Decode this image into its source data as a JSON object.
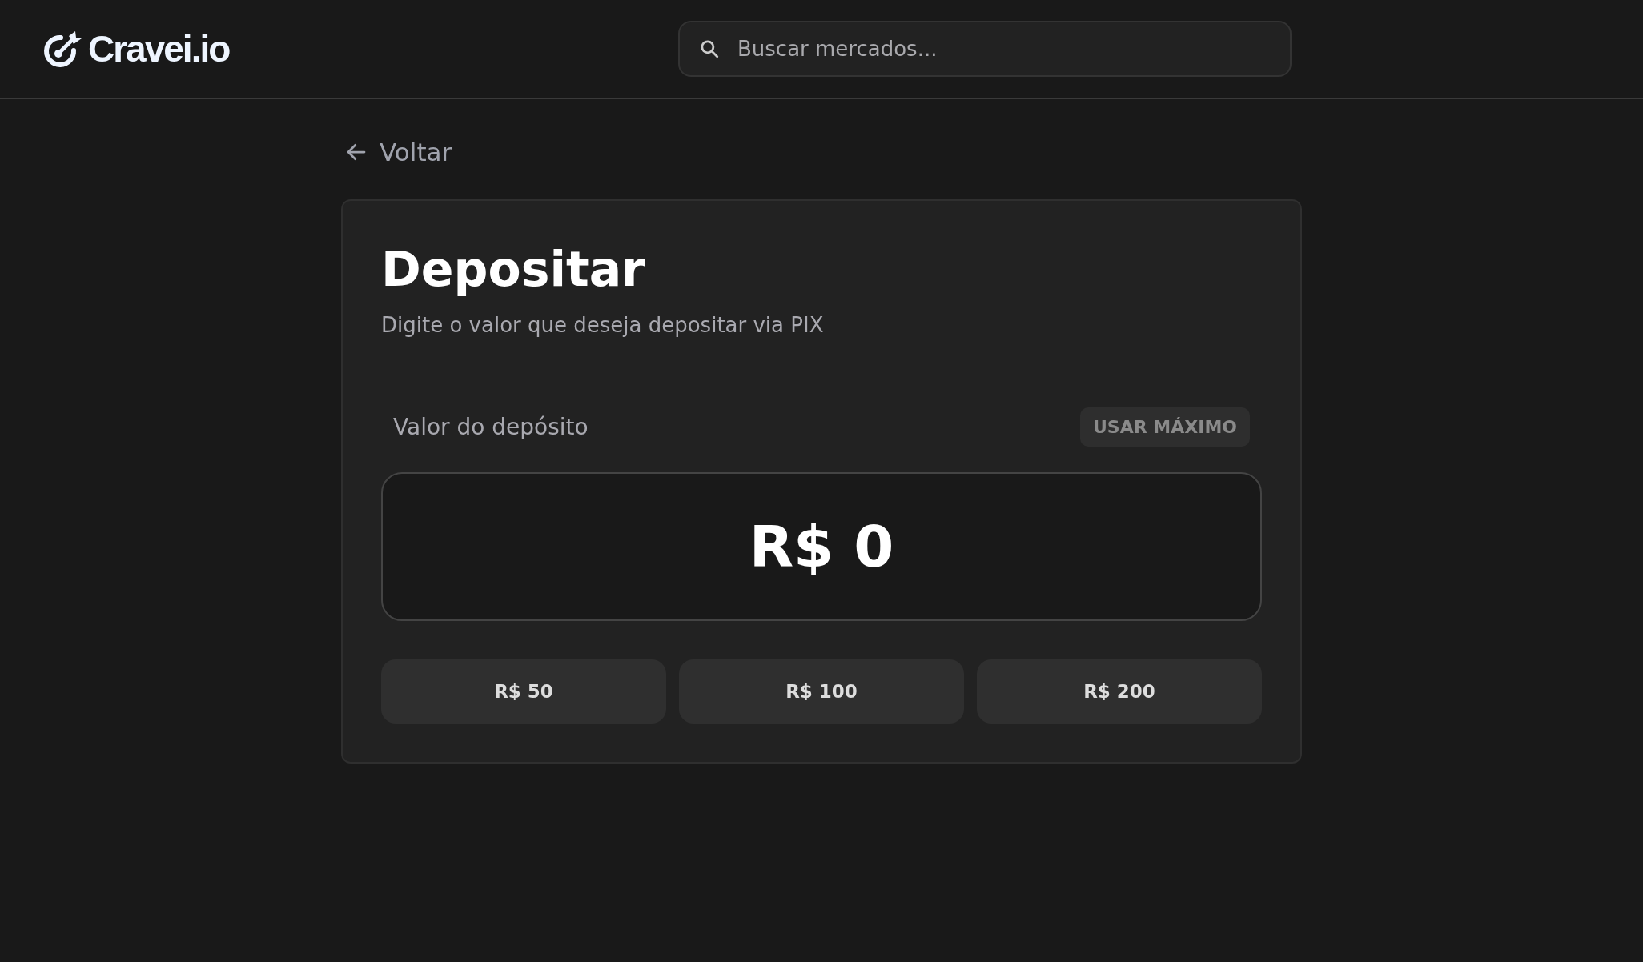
{
  "header": {
    "logo": "Cravei.io",
    "search": {
      "placeholder": "Buscar mercados..."
    }
  },
  "back_link": "Voltar",
  "card": {
    "title": "Depositar",
    "subtitle": "Digite o valor que deseja depositar via PIX",
    "amount_label": "Valor do depósito",
    "max_button": "USAR MÁXIMO",
    "amount": {
      "value": "R$ 0"
    },
    "quick_amounts": [
      "R$ 50",
      "R$ 100",
      "R$ 200"
    ]
  }
}
